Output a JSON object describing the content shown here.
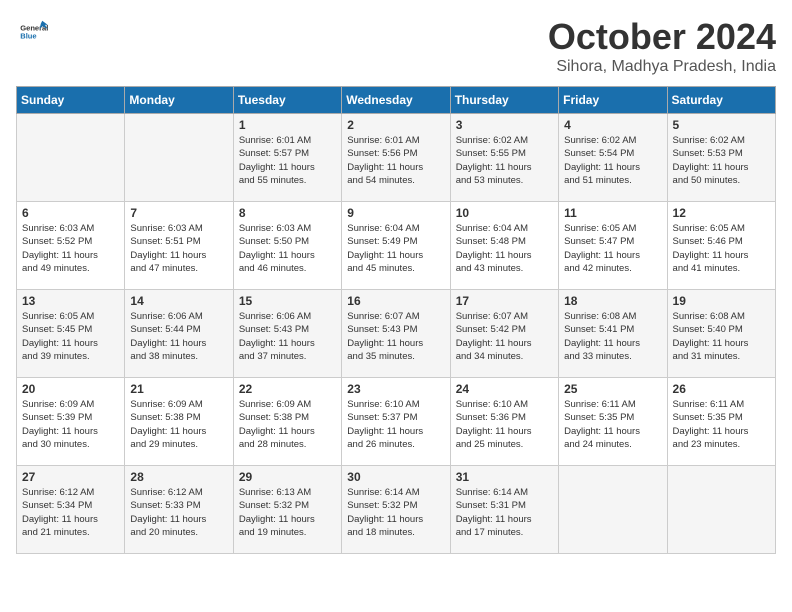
{
  "logo": {
    "general": "General",
    "blue": "Blue"
  },
  "title": {
    "month_year": "October 2024",
    "location": "Sihora, Madhya Pradesh, India"
  },
  "days_of_week": [
    "Sunday",
    "Monday",
    "Tuesday",
    "Wednesday",
    "Thursday",
    "Friday",
    "Saturday"
  ],
  "weeks": [
    [
      {
        "day": "",
        "info": ""
      },
      {
        "day": "",
        "info": ""
      },
      {
        "day": "1",
        "info": "Sunrise: 6:01 AM\nSunset: 5:57 PM\nDaylight: 11 hours\nand 55 minutes."
      },
      {
        "day": "2",
        "info": "Sunrise: 6:01 AM\nSunset: 5:56 PM\nDaylight: 11 hours\nand 54 minutes."
      },
      {
        "day": "3",
        "info": "Sunrise: 6:02 AM\nSunset: 5:55 PM\nDaylight: 11 hours\nand 53 minutes."
      },
      {
        "day": "4",
        "info": "Sunrise: 6:02 AM\nSunset: 5:54 PM\nDaylight: 11 hours\nand 51 minutes."
      },
      {
        "day": "5",
        "info": "Sunrise: 6:02 AM\nSunset: 5:53 PM\nDaylight: 11 hours\nand 50 minutes."
      }
    ],
    [
      {
        "day": "6",
        "info": "Sunrise: 6:03 AM\nSunset: 5:52 PM\nDaylight: 11 hours\nand 49 minutes."
      },
      {
        "day": "7",
        "info": "Sunrise: 6:03 AM\nSunset: 5:51 PM\nDaylight: 11 hours\nand 47 minutes."
      },
      {
        "day": "8",
        "info": "Sunrise: 6:03 AM\nSunset: 5:50 PM\nDaylight: 11 hours\nand 46 minutes."
      },
      {
        "day": "9",
        "info": "Sunrise: 6:04 AM\nSunset: 5:49 PM\nDaylight: 11 hours\nand 45 minutes."
      },
      {
        "day": "10",
        "info": "Sunrise: 6:04 AM\nSunset: 5:48 PM\nDaylight: 11 hours\nand 43 minutes."
      },
      {
        "day": "11",
        "info": "Sunrise: 6:05 AM\nSunset: 5:47 PM\nDaylight: 11 hours\nand 42 minutes."
      },
      {
        "day": "12",
        "info": "Sunrise: 6:05 AM\nSunset: 5:46 PM\nDaylight: 11 hours\nand 41 minutes."
      }
    ],
    [
      {
        "day": "13",
        "info": "Sunrise: 6:05 AM\nSunset: 5:45 PM\nDaylight: 11 hours\nand 39 minutes."
      },
      {
        "day": "14",
        "info": "Sunrise: 6:06 AM\nSunset: 5:44 PM\nDaylight: 11 hours\nand 38 minutes."
      },
      {
        "day": "15",
        "info": "Sunrise: 6:06 AM\nSunset: 5:43 PM\nDaylight: 11 hours\nand 37 minutes."
      },
      {
        "day": "16",
        "info": "Sunrise: 6:07 AM\nSunset: 5:43 PM\nDaylight: 11 hours\nand 35 minutes."
      },
      {
        "day": "17",
        "info": "Sunrise: 6:07 AM\nSunset: 5:42 PM\nDaylight: 11 hours\nand 34 minutes."
      },
      {
        "day": "18",
        "info": "Sunrise: 6:08 AM\nSunset: 5:41 PM\nDaylight: 11 hours\nand 33 minutes."
      },
      {
        "day": "19",
        "info": "Sunrise: 6:08 AM\nSunset: 5:40 PM\nDaylight: 11 hours\nand 31 minutes."
      }
    ],
    [
      {
        "day": "20",
        "info": "Sunrise: 6:09 AM\nSunset: 5:39 PM\nDaylight: 11 hours\nand 30 minutes."
      },
      {
        "day": "21",
        "info": "Sunrise: 6:09 AM\nSunset: 5:38 PM\nDaylight: 11 hours\nand 29 minutes."
      },
      {
        "day": "22",
        "info": "Sunrise: 6:09 AM\nSunset: 5:38 PM\nDaylight: 11 hours\nand 28 minutes."
      },
      {
        "day": "23",
        "info": "Sunrise: 6:10 AM\nSunset: 5:37 PM\nDaylight: 11 hours\nand 26 minutes."
      },
      {
        "day": "24",
        "info": "Sunrise: 6:10 AM\nSunset: 5:36 PM\nDaylight: 11 hours\nand 25 minutes."
      },
      {
        "day": "25",
        "info": "Sunrise: 6:11 AM\nSunset: 5:35 PM\nDaylight: 11 hours\nand 24 minutes."
      },
      {
        "day": "26",
        "info": "Sunrise: 6:11 AM\nSunset: 5:35 PM\nDaylight: 11 hours\nand 23 minutes."
      }
    ],
    [
      {
        "day": "27",
        "info": "Sunrise: 6:12 AM\nSunset: 5:34 PM\nDaylight: 11 hours\nand 21 minutes."
      },
      {
        "day": "28",
        "info": "Sunrise: 6:12 AM\nSunset: 5:33 PM\nDaylight: 11 hours\nand 20 minutes."
      },
      {
        "day": "29",
        "info": "Sunrise: 6:13 AM\nSunset: 5:32 PM\nDaylight: 11 hours\nand 19 minutes."
      },
      {
        "day": "30",
        "info": "Sunrise: 6:14 AM\nSunset: 5:32 PM\nDaylight: 11 hours\nand 18 minutes."
      },
      {
        "day": "31",
        "info": "Sunrise: 6:14 AM\nSunset: 5:31 PM\nDaylight: 11 hours\nand 17 minutes."
      },
      {
        "day": "",
        "info": ""
      },
      {
        "day": "",
        "info": ""
      }
    ]
  ]
}
